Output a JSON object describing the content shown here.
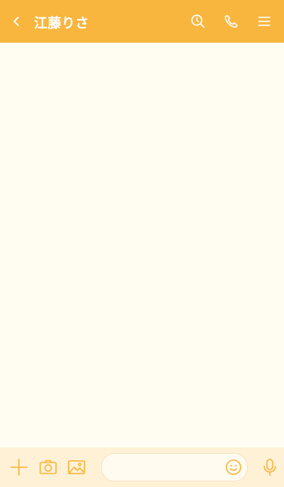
{
  "header": {
    "title": "江藤りさ",
    "icons": [
      "back-icon",
      "search-icon",
      "phone-icon",
      "menu-icon"
    ]
  },
  "footer": {
    "message_placeholder": "",
    "icons": [
      "plus-icon",
      "camera-icon",
      "image-icon",
      "emoji-icon",
      "mic-icon"
    ]
  },
  "colors": {
    "header_bg": "#f8b63f",
    "chat_bg": "#fffdf2",
    "footer_bg": "#fef1d6",
    "accent": "#f8b63f"
  }
}
